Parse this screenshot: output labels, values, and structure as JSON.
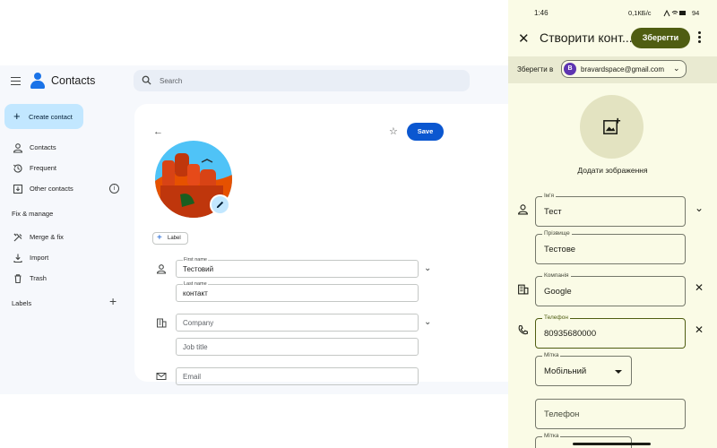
{
  "web": {
    "app_title": "Contacts",
    "search_placeholder": "Search",
    "create_contact_label": "Create contact",
    "nav": [
      {
        "label": "Contacts",
        "icon": "person-icon"
      },
      {
        "label": "Frequent",
        "icon": "history-icon"
      },
      {
        "label": "Other contacts",
        "icon": "download-box-icon"
      }
    ],
    "fix_manage_title": "Fix & manage",
    "fix_items": [
      {
        "label": "Merge & fix",
        "icon": "tools-icon"
      },
      {
        "label": "Import",
        "icon": "import-icon"
      },
      {
        "label": "Trash",
        "icon": "trash-icon"
      }
    ],
    "labels_title": "Labels",
    "form": {
      "save_label": "Save",
      "label_chip": "Label",
      "first_name_label": "First name",
      "first_name_value": "Тестовий",
      "last_name_label": "Last name",
      "last_name_value": "контакт",
      "company_placeholder": "Company",
      "job_title_placeholder": "Job title",
      "email_placeholder": "Email"
    },
    "colors": {
      "accent": "#0b57d0",
      "create_bg": "#c2e7ff",
      "bg": "#f6f8fc"
    }
  },
  "phone": {
    "status": {
      "time": "1:46",
      "rate": "0,1КБ/с",
      "battery": "94"
    },
    "title": "Створити конт...",
    "save_label": "Зберегти",
    "save_to_label": "Зберегти в",
    "account_initial": "B",
    "account_email": "bravardspace@gmail.com",
    "add_photo_label": "Додати зображення",
    "first_name_label": "Ім'я",
    "first_name_value": "Тест",
    "last_name_label": "Прізвище",
    "last_name_value": "Тестове",
    "company_label": "Компанія",
    "company_value": "Google",
    "phone_label": "Телефон",
    "phone_value": "80935680000",
    "type_label": "Мітка",
    "type_value": "Мобільний",
    "phone2_placeholder": "Телефон",
    "type2_label": "Мітка",
    "colors": {
      "bg": "#fafbe6",
      "save_bg": "#4f5d12",
      "account_bar": "#e9ead1"
    }
  }
}
